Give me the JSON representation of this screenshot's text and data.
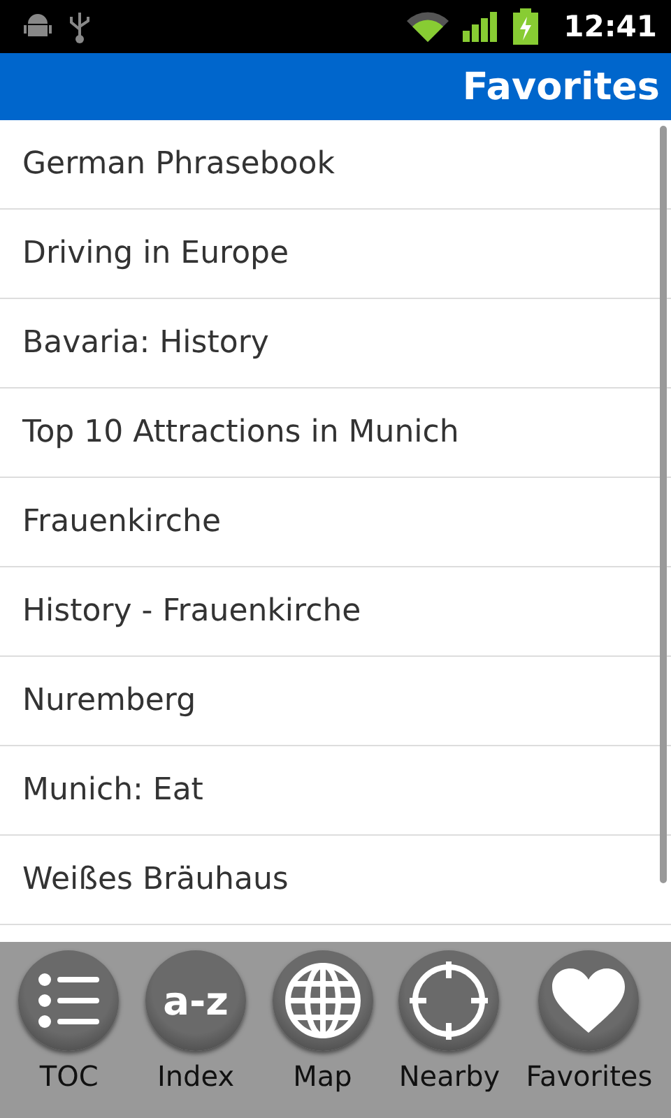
{
  "status_bar": {
    "time": "12:41"
  },
  "title_bar": {
    "title": "Favorites"
  },
  "favorites": [
    {
      "label": "German Phrasebook"
    },
    {
      "label": "Driving in Europe"
    },
    {
      "label": "Bavaria: History"
    },
    {
      "label": "Top 10 Attractions in Munich"
    },
    {
      "label": "Frauenkirche"
    },
    {
      "label": "History - Frauenkirche"
    },
    {
      "label": "Nuremberg"
    },
    {
      "label": "Munich: Eat"
    },
    {
      "label": "Weißes Bräuhaus"
    }
  ],
  "bottom_nav": [
    {
      "kind": "list",
      "label": "TOC"
    },
    {
      "kind": "text",
      "icon_text": "a-z",
      "label": "Index"
    },
    {
      "kind": "globe",
      "label": "Map"
    },
    {
      "kind": "target",
      "label": "Nearby"
    },
    {
      "kind": "heart",
      "label": "Favorites"
    }
  ]
}
